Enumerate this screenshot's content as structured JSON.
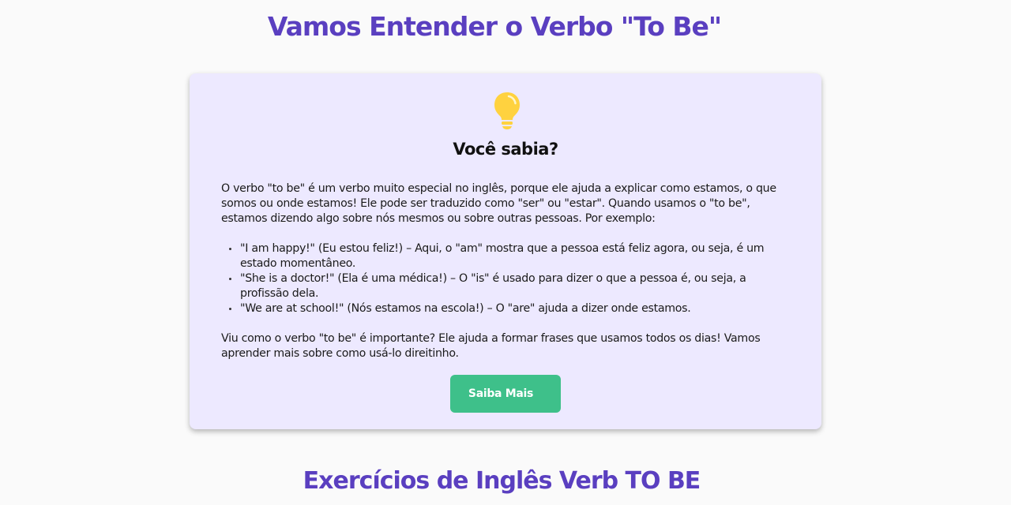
{
  "header": {
    "title": "Vamos Entender o Verbo \"To Be\""
  },
  "card": {
    "icon": "lightbulb-icon",
    "heading": "Você sabia?",
    "intro": "O verbo \"to be\" é um verbo muito especial no inglês, porque ele ajuda a explicar como estamos, o que somos ou onde estamos! Ele pode ser traduzido como \"ser\" ou \"estar\". Quando usamos o \"to be\", estamos dizendo algo sobre nós mesmos ou sobre outras pessoas. Por exemplo:",
    "examples": [
      "\"I am happy!\" (Eu estou feliz!) – Aqui, o \"am\" mostra que a pessoa está feliz agora, ou seja, é um estado momentâneo.",
      "\"She is a doctor!\" (Ela é uma médica!) – O \"is\" é usado para dizer o que a pessoa é, ou seja, a profissão dela.",
      "\"We are at school!\" (Nós estamos na escola!) – O \"are\" ajuda a dizer onde estamos."
    ],
    "outro": "Viu como o verbo \"to be\" é importante? Ele ajuda a formar frases que usamos todos os dias! Vamos aprender mais sobre como usá-lo direitinho.",
    "button_label": "Saiba Mais"
  },
  "exercises": {
    "title": "Exercícios de Inglês Verb TO BE"
  },
  "colors": {
    "accent": "#5a3fc0",
    "card_background": "#ede9ff",
    "button": "#3ec08a",
    "bulb": "#ffd23f"
  }
}
